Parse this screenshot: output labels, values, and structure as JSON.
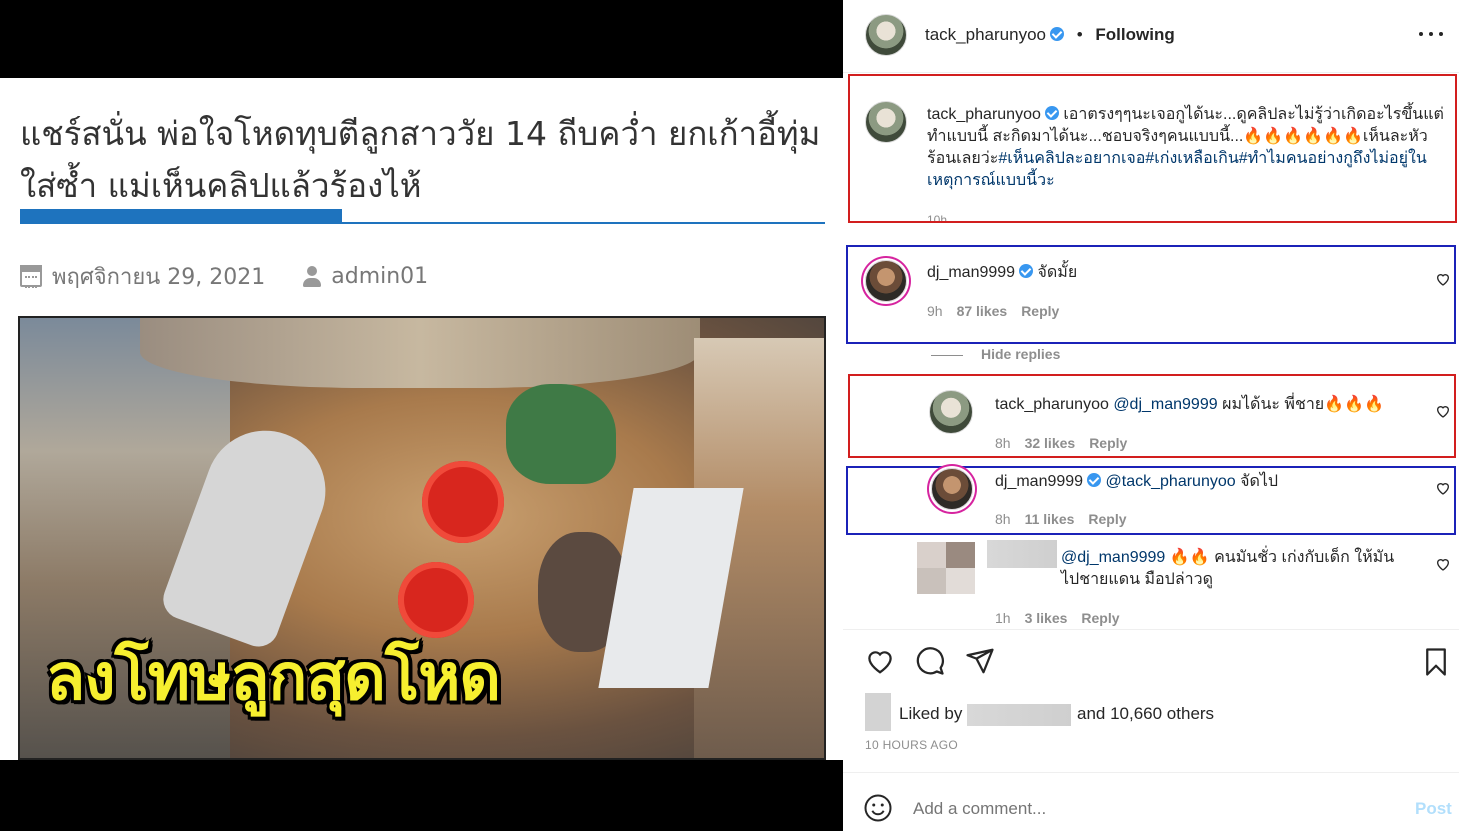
{
  "article": {
    "headline": "แชร์สนั่น พ่อใจโหดทุบตีลูกสาววัย 14 ถีบคว่ำ ยกเก้าอี้ทุ่มใส่ซ้ำ แม่เห็นคลิปแล้วร้องไห้",
    "date": "พฤศจิกายน 29, 2021",
    "author": "admin01",
    "image_caption": "ลงโทษลูกสุดโหด",
    "accent_color": "#1e73be"
  },
  "post": {
    "username": "tack_pharunyoo",
    "follow_status": "Following",
    "separator": "•",
    "more_icon": "more-horizontal-icon",
    "caption_text": "เอาตรงๆๆนะเจอกูได้นะ...ดูคลิปละไม่รู้ว่าเกิดอะไรขึ้นแต่ทำแบบนี้ สะกิดมาได้นะ...ชอบจริงๆคนแบบนี้...",
    "caption_emojis": "🔥🔥🔥🔥🔥🔥",
    "caption_after": "เห็นละหัวร้อนเลยว่ะ",
    "caption_tags": "#เห็นคลิปละอยากเจอ#เก่งเหลือเกิน#ทำไมคนอย่างกูถึงไม่อยู่ในเหตุการณ์แบบนี้วะ",
    "caption_time": "10h"
  },
  "comments": [
    {
      "user": "dj_man9999",
      "text": "จัดมั้ย",
      "time": "9h",
      "likes": "87 likes",
      "reply": "Reply"
    },
    {
      "user": "tack_pharunyoo",
      "mention": "@dj_man9999",
      "text": "ผมได้นะ พี่ชาย",
      "emojis": "🔥🔥🔥",
      "time": "8h",
      "likes": "32 likes",
      "reply": "Reply"
    },
    {
      "user": "dj_man9999",
      "mention": "@tack_pharunyoo",
      "text": "จัดไป",
      "time": "8h",
      "likes": "11 likes",
      "reply": "Reply"
    },
    {
      "mention": "@dj_man9999",
      "emojis": "🔥🔥",
      "text": "คนมันชั่ว เก่งกับเด็ก ให้มันไปชายแดน มือปล่าวดู",
      "time": "1h",
      "likes": "3 likes",
      "reply": "Reply"
    }
  ],
  "hide_replies": "Hide replies",
  "actions": {
    "like_icon": "heart-icon",
    "comment_icon": "comment-icon",
    "share_icon": "share-icon",
    "save_icon": "bookmark-icon"
  },
  "likes": {
    "prefix": "Liked by",
    "suffix": "and 10,660 others",
    "timestamp": "10 HOURS AGO"
  },
  "add_comment": {
    "placeholder": "Add a comment...",
    "post_label": "Post",
    "emoji_icon": "smiley-icon"
  },
  "colors": {
    "red_box": "#d21e1e",
    "blue_box": "#1b22b8",
    "verified": "#3897f0",
    "link": "#00376b",
    "post_button": "#b2dffc"
  }
}
